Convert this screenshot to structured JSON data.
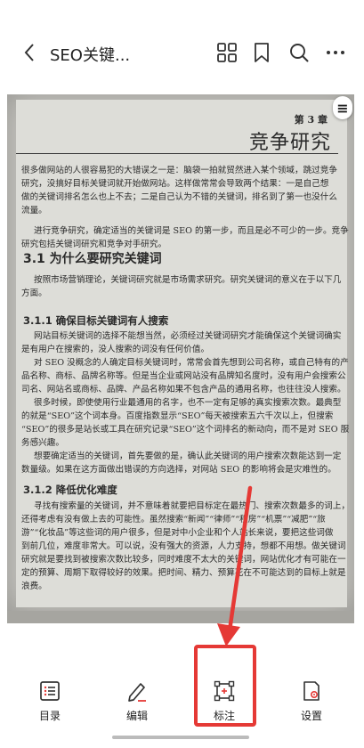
{
  "header": {
    "title": "SEO关键..."
  },
  "icons": {
    "back": "back-arrow-icon",
    "grid": "grid-icon",
    "bookmark": "bookmark-icon",
    "search": "search-icon",
    "more": "more-icon",
    "menu": "menu-icon"
  },
  "doc": {
    "chapter": "第 3 章",
    "chapter_title": "竞争研究",
    "intro": [
      "很多做网站的人很容易犯的大错误之一是：脑袋一拍就贸然进入某个领域，跳过竞争",
      "研究，没搞好目标关键词就开始做网站。这样做常常会导致两个结果：一是自己想",
      "做的关键词排名怎么也上不去；二是自己认为不错的关键词，排名到了第一也没什么",
      "流量。",
      "进行竞争研究，确定适当的关键词是 SEO 的第一步，而且是必不可少的一步。竞争",
      "研究包括关键词研究和竞争对手研究。"
    ],
    "s31_title": "3.1  为什么要研究关键词",
    "s31_text": [
      "按照市场营销理论，关键词研究就是市场需求研究。研究关键词的意义在于以下几",
      "方面。"
    ],
    "s311_title": "3.1.1  确保目标关键词有人搜索",
    "s311_text": [
      "网站目标关键词的选择不能想当然，必须经过关键词研究才能确保这个关键词确实",
      "是有用户在搜索的，没人搜索的词没有任何价值。",
      "对 SEO 没概念的人确定目标关键词时，常常会首先想到公司名称，或自己特有的产",
      "品名称、商标、品牌名称等。但是当企业或网站没有品牌知名度时，没有用户会搜索公",
      "司名、网站名或商标、品牌、产品名称如果不包含产品的通用名称，也往往没人搜索。",
      "很多时候，即使使用行业最通用的名字，也不一定有足够的真实搜索次数。最典型",
      "的就是“SEO”这个词本身。百度指数显示“SEO”每天被搜索五六千次以上，但搜索",
      "“SEO”的很多是站长或工具在研究记录“SEO”这个词排名的新动向，而不是对 SEO 服",
      "务感兴趣。",
      "想要确定适当的关键词，首先要做的是，确认此关键词的用户搜索次数能达到一定",
      "数量级。如果在这方面做出错误的方向选择，对网站 SEO 的影响将会是灾难性的。"
    ],
    "s312_title": "3.1.2  降低优化难度",
    "s312_text": [
      "寻找有搜索量的关键词，并不意味着就要把目标定在最热门、搜索次数最多的词上，",
      "还得考虑有没有做上去的可能性。虽然搜索“新闻”“律师”“租房”“机票”“减肥”“旅",
      "游”“化妆品”等这些词的用户很多，但是对中小企业和个人站长来说，要把这些词做",
      "到前几位，难度非常大。可以说，没有强大的资源，人力支持，想都不用想。做关键词",
      "研究就是要找到被搜索次数比较多，同时难度不太大的关键词，网站优化才有可能在一",
      "定的预算、周期下取得较好的效果。把时间、精力、预算花在不可能达到的目标上就是",
      "浪费。"
    ]
  },
  "toolbar": {
    "items": [
      {
        "label": "目录",
        "icon": "catalog-icon"
      },
      {
        "label": "编辑",
        "icon": "edit-icon"
      },
      {
        "label": "标注",
        "icon": "annotate-icon"
      },
      {
        "label": "设置",
        "icon": "settings-icon"
      }
    ],
    "highlight_color": "#e53935"
  }
}
